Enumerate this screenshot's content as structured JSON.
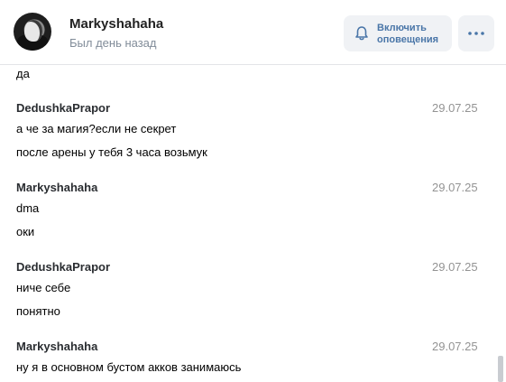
{
  "header": {
    "user_name": "Markyshahaha",
    "status": "Был день назад",
    "notify_button": "Включить оповещения",
    "more_icon": "more-dots-icon",
    "bell_icon": "bell-icon"
  },
  "messages": {
    "partial_top": "да",
    "groups": [
      {
        "author": "DedushkaPrapor",
        "date": "29.07.25",
        "lines": [
          "а че за магия?если не секрет",
          "после арены у тебя 3 часа возьмук"
        ]
      },
      {
        "author": "Markyshahaha",
        "date": "29.07.25",
        "lines": [
          "dma",
          "оки"
        ]
      },
      {
        "author": "DedushkaPrapor",
        "date": "29.07.25",
        "lines": [
          "ниче себе",
          "понятно"
        ]
      },
      {
        "author": "Markyshahaha",
        "date": "29.07.25",
        "lines": [
          "ну я в основном бустом акков занимаюсь"
        ]
      }
    ]
  },
  "colors": {
    "accent": "#4a76a8",
    "button_bg": "#f0f2f5",
    "muted": "#818c99"
  }
}
